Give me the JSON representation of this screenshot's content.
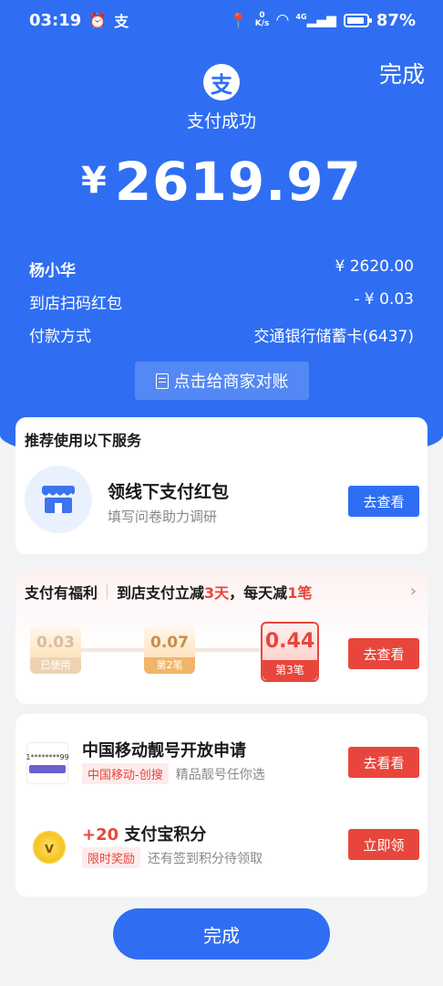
{
  "status_bar": {
    "time": "03:19",
    "net_speed_value": "0",
    "net_speed_unit": "K/s",
    "network": "4G",
    "battery": "87%"
  },
  "header": {
    "done_label": "完成",
    "logo_char": "支",
    "status_text": "支付成功"
  },
  "amount": {
    "currency": "¥",
    "value": "2619.97"
  },
  "details": [
    {
      "label": "杨小华",
      "value": "¥ 2620.00"
    },
    {
      "label": "到店扫码红包",
      "value": "- ¥ 0.03"
    },
    {
      "label": "付款方式",
      "value": "交通银行储蓄卡(6437)"
    }
  ],
  "reconcile_button": "点击给商家对账",
  "recommend": {
    "title": "推荐使用以下服务",
    "item_title": "领线下支付红包",
    "item_subtitle": "填写问卷助力调研",
    "button": "去查看"
  },
  "welfare": {
    "title": "支付有福利",
    "desc_prefix": "到店支付立减",
    "days": "3天",
    "desc_mid": "，每天减",
    "count": "1笔",
    "coupons": [
      {
        "value": "0.03",
        "tag": "已使用"
      },
      {
        "value": "0.07",
        "tag": "第2笔"
      },
      {
        "value": "0.44",
        "tag": "第3笔"
      }
    ],
    "button": "去查看"
  },
  "offers": [
    {
      "icon_text": "1********99",
      "title": "中国移动靓号开放申请",
      "tag": "中国移动-创搜",
      "desc": "精品靓号任你选",
      "button": "去看看"
    },
    {
      "icon_text": "v",
      "title_highlight": "+20",
      "title": " 支付宝积分",
      "tag": "限时奖励",
      "desc": "还有签到积分待领取",
      "button": "立即领"
    }
  ],
  "bottom_button": "完成",
  "colors": {
    "brand_blue": "#2f6ef3",
    "accent_red": "#e8463c"
  }
}
